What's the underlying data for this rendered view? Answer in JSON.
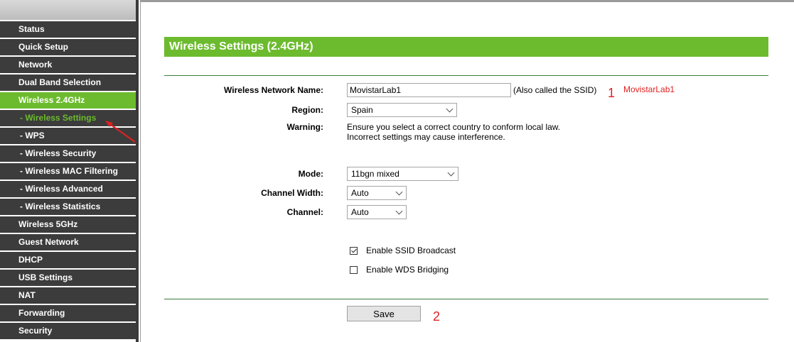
{
  "sidebar": {
    "items": [
      {
        "label": "Status",
        "sub": false,
        "active": false
      },
      {
        "label": "Quick Setup",
        "sub": false,
        "active": false
      },
      {
        "label": "Network",
        "sub": false,
        "active": false
      },
      {
        "label": "Dual Band Selection",
        "sub": false,
        "active": false
      },
      {
        "label": "Wireless 2.4GHz",
        "sub": false,
        "active": true
      },
      {
        "label": "- Wireless Settings",
        "sub": true,
        "current": true
      },
      {
        "label": "- WPS",
        "sub": true
      },
      {
        "label": "- Wireless Security",
        "sub": true
      },
      {
        "label": "- Wireless MAC Filtering",
        "sub": true
      },
      {
        "label": "- Wireless Advanced",
        "sub": true
      },
      {
        "label": "- Wireless Statistics",
        "sub": true
      },
      {
        "label": "Wireless 5GHz",
        "sub": false
      },
      {
        "label": "Guest Network",
        "sub": false
      },
      {
        "label": "DHCP",
        "sub": false
      },
      {
        "label": "USB Settings",
        "sub": false
      },
      {
        "label": "NAT",
        "sub": false
      },
      {
        "label": "Forwarding",
        "sub": false
      },
      {
        "label": "Security",
        "sub": false
      }
    ]
  },
  "page": {
    "title": "Wireless Settings (2.4GHz)"
  },
  "form": {
    "ssid": {
      "label": "Wireless Network Name:",
      "value": "MovistarLab1",
      "note": "(Also called the SSID)"
    },
    "region": {
      "label": "Region:",
      "value": "Spain"
    },
    "warning": {
      "label": "Warning:",
      "line1": "Ensure you select a correct country to conform local law.",
      "line2": "Incorrect settings may cause interference."
    },
    "mode": {
      "label": "Mode:",
      "value": "11bgn mixed"
    },
    "channel_width": {
      "label": "Channel Width:",
      "value": "Auto"
    },
    "channel": {
      "label": "Channel:",
      "value": "Auto"
    },
    "ssid_broadcast": {
      "label": "Enable SSID Broadcast",
      "checked": true
    },
    "wds_bridging": {
      "label": "Enable WDS Bridging",
      "checked": false
    },
    "save_label": "Save"
  },
  "annotations": {
    "one": "1",
    "one_text": "MovistarLab1",
    "two": "2"
  },
  "colors": {
    "accent": "#6cbb2e",
    "nav_bg": "#3c3c3c",
    "annotation": "#e02020"
  }
}
